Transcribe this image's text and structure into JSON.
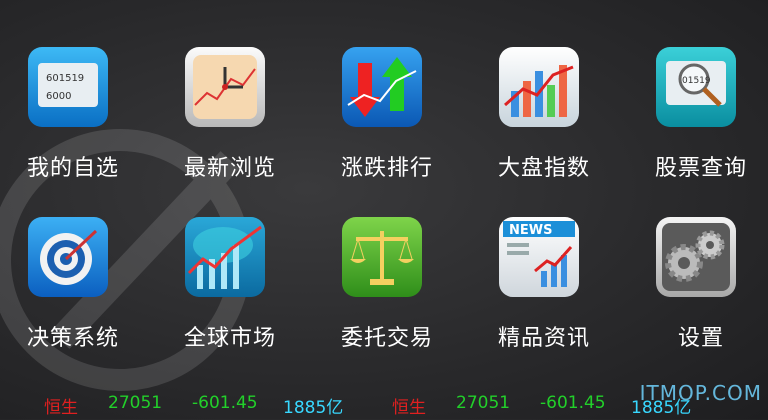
{
  "menu": [
    {
      "label": "我的自选",
      "icon": "quote-panel-icon"
    },
    {
      "label": "最新浏览",
      "icon": "clock-chart-icon"
    },
    {
      "label": "涨跌排行",
      "icon": "up-down-arrows-icon"
    },
    {
      "label": "大盘指数",
      "icon": "bar-trend-chart-icon"
    },
    {
      "label": "股票查询",
      "icon": "magnifier-search-icon"
    },
    {
      "label": "决策系统",
      "icon": "target-icon"
    },
    {
      "label": "全球市场",
      "icon": "globe-chart-icon"
    },
    {
      "label": "委托交易",
      "icon": "scales-icon"
    },
    {
      "label": "精品资讯",
      "icon": "news-icon"
    },
    {
      "label": "设置",
      "icon": "gears-icon"
    }
  ],
  "icon_text": {
    "quote_a": "601519",
    "quote_b": "6000",
    "search_num": "01519",
    "news": "NEWS"
  },
  "ticker": [
    {
      "name": "恒生",
      "value": "27051",
      "change": "-601.45",
      "volume": "1885亿"
    },
    {
      "name": "恒生",
      "value": "27051",
      "change": "-601.45",
      "volume": "1885亿"
    }
  ],
  "watermark": "ITMOP.COM",
  "colors": {
    "up": "#e02020",
    "down": "#22d02a",
    "volume": "#38d8ff"
  }
}
